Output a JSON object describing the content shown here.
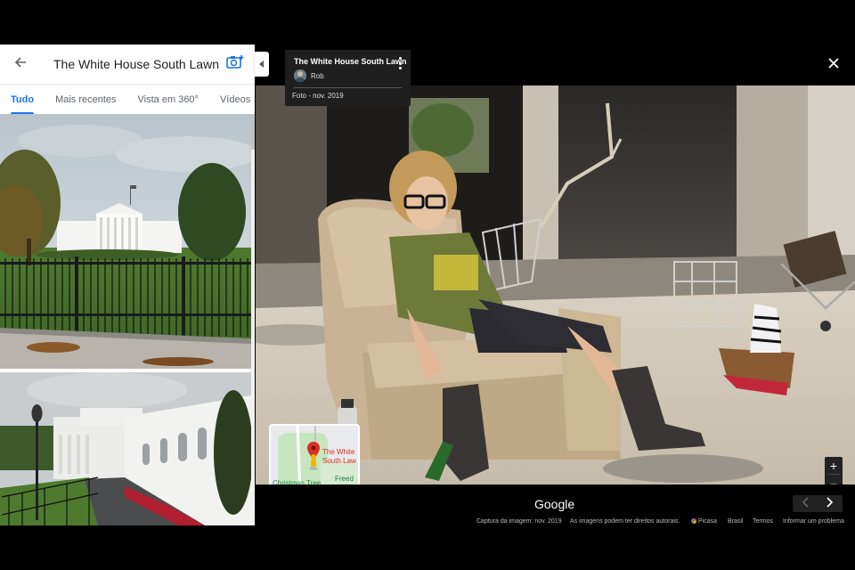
{
  "panel": {
    "title": "The White House South Lawn",
    "tabs": [
      {
        "label": "Tudo",
        "active": true
      },
      {
        "label": "Mais recentes",
        "active": false
      },
      {
        "label": "Vista em 360°",
        "active": false
      },
      {
        "label": "Vídeos",
        "active": false
      }
    ]
  },
  "info_card": {
    "title": "The White House South Lawn",
    "author": "Rob",
    "date": "Foto - nov. 2019"
  },
  "minimap": {
    "place_line1": "The White",
    "place_line2": "South Law",
    "christmas_tree": "Christmas Tree",
    "freed": "Freed"
  },
  "footer": {
    "brand": "Google",
    "capture": "Captura da imagem: nov. 2019",
    "rights": "As imagens podem ter direitos autorais.",
    "picasa": "Picasa",
    "country": "Brasil",
    "terms": "Termos",
    "report": "Informar um problema"
  },
  "colors": {
    "accent": "#1a73e8",
    "pin": "#d93025",
    "background": "#000000"
  }
}
